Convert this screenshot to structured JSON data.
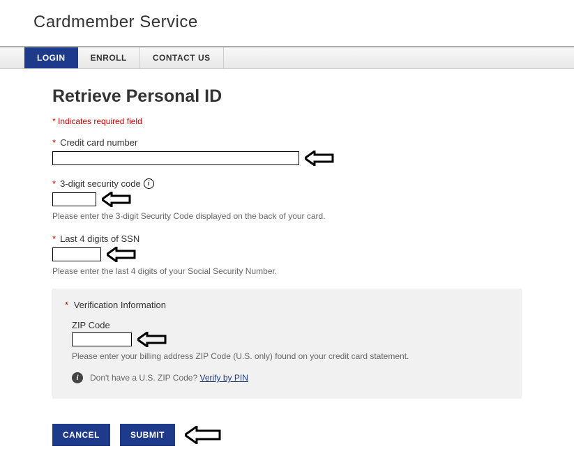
{
  "header": {
    "brand": "Cardmember Service"
  },
  "nav": {
    "tabs": [
      {
        "label": "LOGIN",
        "active": true
      },
      {
        "label": "ENROLL",
        "active": false
      },
      {
        "label": "CONTACT US",
        "active": false
      }
    ]
  },
  "page": {
    "title": "Retrieve Personal ID",
    "required_note": "* Indicates required field"
  },
  "fields": {
    "credit_card": {
      "label": "Credit card number",
      "value": ""
    },
    "security_code": {
      "label": "3-digit security code",
      "value": "",
      "help": "Please enter the 3-digit Security Code displayed on the back of your card."
    },
    "ssn": {
      "label": "Last 4 digits of SSN",
      "value": "",
      "help": "Please enter the last 4 digits of your Social Security Number."
    }
  },
  "verification": {
    "title": "Verification Information",
    "zip": {
      "label": "ZIP Code",
      "value": "",
      "help": "Please enter your billing address ZIP Code (U.S. only) found on your credit card statement."
    },
    "no_zip_text": "Don't have a U.S. ZIP Code? ",
    "verify_link": "Verify by PIN"
  },
  "buttons": {
    "cancel": "CANCEL",
    "submit": "SUBMIT"
  }
}
